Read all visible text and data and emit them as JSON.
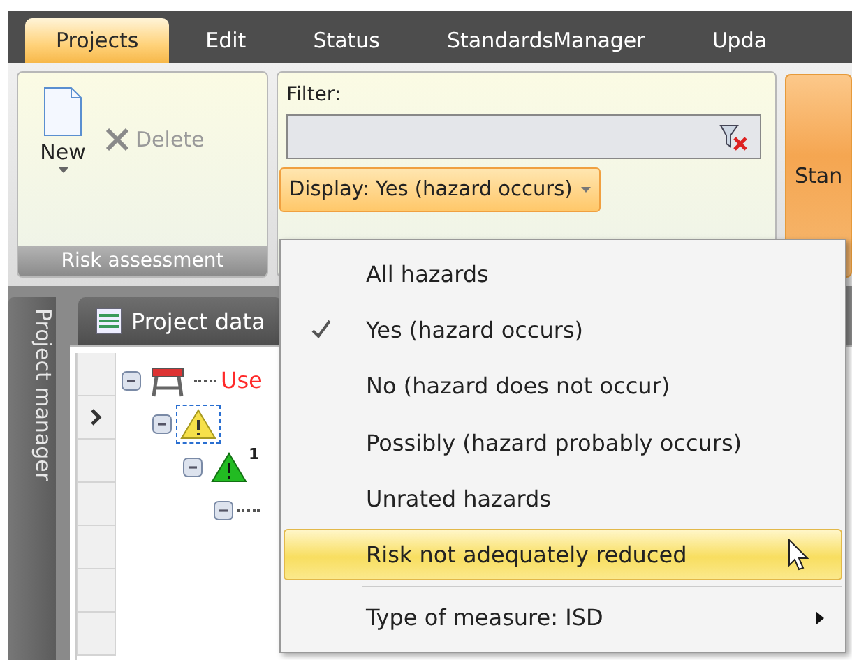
{
  "menu_bar": {
    "tabs": [
      {
        "label": "Projects",
        "selected": true
      },
      {
        "label": "Edit",
        "selected": false
      },
      {
        "label": "Status",
        "selected": false
      },
      {
        "label": "StandardsManager",
        "selected": false
      },
      {
        "label": "Upda",
        "selected": false
      }
    ]
  },
  "ribbon": {
    "risk_group": {
      "new_label": "New",
      "delete_label": "Delete",
      "delete_disabled": true,
      "caption": "Risk assessment"
    },
    "filter_group": {
      "label": "Filter:",
      "display_label": "Display: Yes (hazard occurs)"
    },
    "standards_button": {
      "label": "Stan"
    }
  },
  "side_tab": {
    "label": "Project manager"
  },
  "document_tab": {
    "label": "Project data"
  },
  "grid": {
    "rows": [
      {
        "current": false
      },
      {
        "current": true
      },
      {
        "current": false
      },
      {
        "current": false
      },
      {
        "current": false
      },
      {
        "current": false
      },
      {
        "current": false
      }
    ]
  },
  "tree": [
    {
      "kind": "barrier",
      "label": "Use",
      "expanded": true,
      "children": [
        {
          "kind": "warning",
          "expanded": true,
          "selected": true,
          "children": [
            {
              "kind": "warning-green",
              "badge": "1",
              "expanded": true,
              "children": [
                {
                  "expanded": true
                }
              ]
            }
          ]
        }
      ]
    }
  ],
  "dropdown_menu": {
    "items": [
      {
        "label": "All hazards",
        "kind": "option",
        "checked": false,
        "highlighted": false
      },
      {
        "label": "Yes (hazard occurs)",
        "kind": "option",
        "checked": true,
        "highlighted": false
      },
      {
        "label": "No (hazard does not occur)",
        "kind": "option",
        "checked": false,
        "highlighted": false
      },
      {
        "label": "Possibly (hazard probably occurs)",
        "kind": "option",
        "checked": false,
        "highlighted": false
      },
      {
        "label": "Unrated hazards",
        "kind": "option",
        "checked": false,
        "highlighted": false
      },
      {
        "label": "Risk not adequately reduced",
        "kind": "option",
        "checked": false,
        "highlighted": true
      },
      {
        "label": "Type of measure: ISD",
        "kind": "submenu",
        "checked": false,
        "highlighted": false
      }
    ]
  }
}
